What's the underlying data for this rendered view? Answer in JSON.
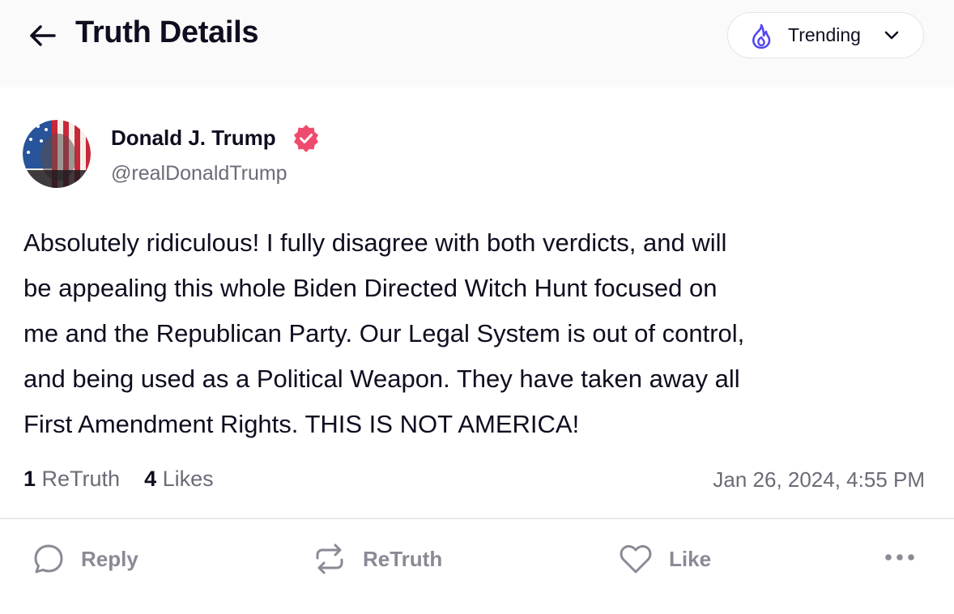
{
  "header": {
    "back_icon": "arrow-left-icon",
    "title": "Truth Details",
    "feed_selector": {
      "icon": "flame-icon",
      "label": "Trending",
      "chevron": "chevron-down-icon"
    }
  },
  "post": {
    "author": {
      "name": "Donald J. Trump",
      "handle": "@realDonaldTrump",
      "verified_icon": "verified-badge-icon",
      "verified_color": "#ef4b6f"
    },
    "body_lines": [
      "Absolutely ridiculous! I fully disagree with both verdicts, and will",
      "be appealing this whole Biden Directed Witch Hunt focused on",
      "me and the Republican Party. Our Legal System is out of control,",
      "and being used as a Political Weapon. They have taken away all",
      "First Amendment Rights. THIS IS NOT AMERICA!"
    ],
    "stats": {
      "retruths_count": "1",
      "retruths_label": "ReTruth",
      "likes_count": "4",
      "likes_label": "Likes"
    },
    "timestamp": "Jan 26, 2024, 4:55 PM"
  },
  "actions": {
    "reply": {
      "label": "Reply",
      "icon": "reply-bubble-icon"
    },
    "retruth": {
      "label": "ReTruth",
      "icon": "retruth-arrows-icon"
    },
    "like": {
      "label": "Like",
      "icon": "heart-icon"
    },
    "more": {
      "icon": "more-dots-icon"
    }
  },
  "colors": {
    "text_primary": "#0f0d1f",
    "text_secondary": "#6b6b78",
    "action_gray": "#8a8a96",
    "accent_purple": "#5448ee"
  }
}
